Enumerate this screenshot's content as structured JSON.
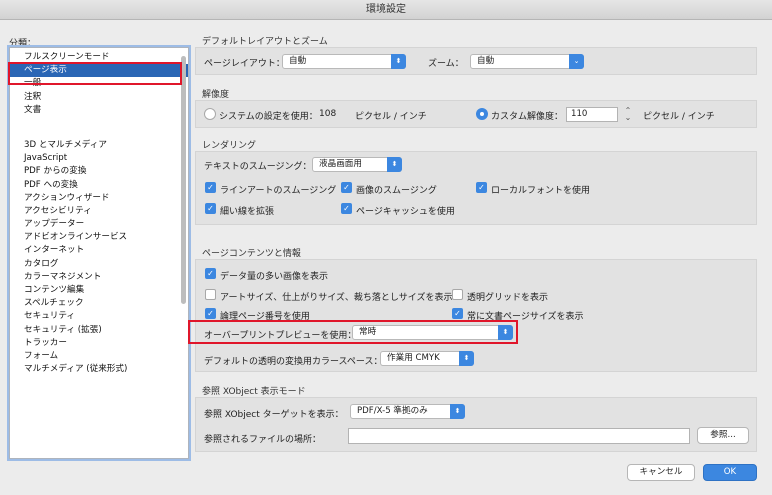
{
  "window": {
    "title": "環境設定"
  },
  "categories": {
    "label": "分類：",
    "group1": [
      "フルスクリーンモード",
      "ページ表示",
      "一般",
      "注釈",
      "文書"
    ],
    "group2": [
      "3D とマルチメディア",
      "JavaScript",
      "PDF からの変換",
      "PDF への変換",
      "アクションウィザード",
      "アクセシビリティ",
      "アップデーター",
      "アドビオンラインサービス",
      "インターネット",
      "カタログ",
      "カラーマネジメント",
      "コンテンツ編集",
      "スペルチェック",
      "セキュリティ",
      "セキュリティ (拡張)",
      "トラッカー",
      "フォーム",
      "マルチメディア (従来形式)"
    ],
    "selected": "ページ表示"
  },
  "layout_zoom": {
    "title": "デフォルトレイアウトとズーム",
    "page_layout_label": "ページレイアウト：",
    "page_layout_value": "自動",
    "zoom_label": "ズーム：",
    "zoom_value": "自動"
  },
  "resolution": {
    "title": "解像度",
    "system_label": "システムの設定を使用：",
    "system_value": "108",
    "unit1": "ピクセル / インチ",
    "custom_label": "カスタム解像度：",
    "custom_value": "110",
    "unit2": "ピクセル / インチ",
    "selected": "custom"
  },
  "rendering": {
    "title": "レンダリング",
    "smoothing_label": "テキストのスムージング：",
    "smoothing_value": "液晶画面用",
    "line_art": "ラインアートのスムージング",
    "images": "画像のスムージング",
    "local_fonts": "ローカルフォントを使用",
    "thin_lines": "細い線を拡張",
    "page_cache": "ページキャッシュを使用"
  },
  "page_content": {
    "title": "ページコンテンツと情報",
    "large_images": "データ量の多い画像を表示",
    "sizes": "アートサイズ、仕上がりサイズ、裁ち落としサイズを表示",
    "transparency_grid": "透明グリッドを表示",
    "logical_page": "論理ページ番号を使用",
    "doc_page_size": "常に文書ページサイズを表示",
    "overprint_label": "オーバープリントプレビューを使用：",
    "overprint_value": "常時",
    "blend_label": "デフォルトの透明の変換用カラースペース：",
    "blend_value": "作業用 CMYK"
  },
  "xobject": {
    "title": "参照 XObject 表示モード",
    "target_label": "参照 XObject ターゲットを表示：",
    "target_value": "PDF/X-5 準拠のみ",
    "location_label": "参照されるファイルの場所：",
    "location_value": "",
    "browse": "参照..."
  },
  "footer": {
    "cancel": "キャンセル",
    "ok": "OK"
  },
  "colors": {
    "accent": "#3c87e0",
    "selection": "#2a66b5",
    "highlight": "#e0162b"
  },
  "icons": {
    "popup_arrow": "chevron-updown-icon",
    "checkmark": "check-icon"
  }
}
